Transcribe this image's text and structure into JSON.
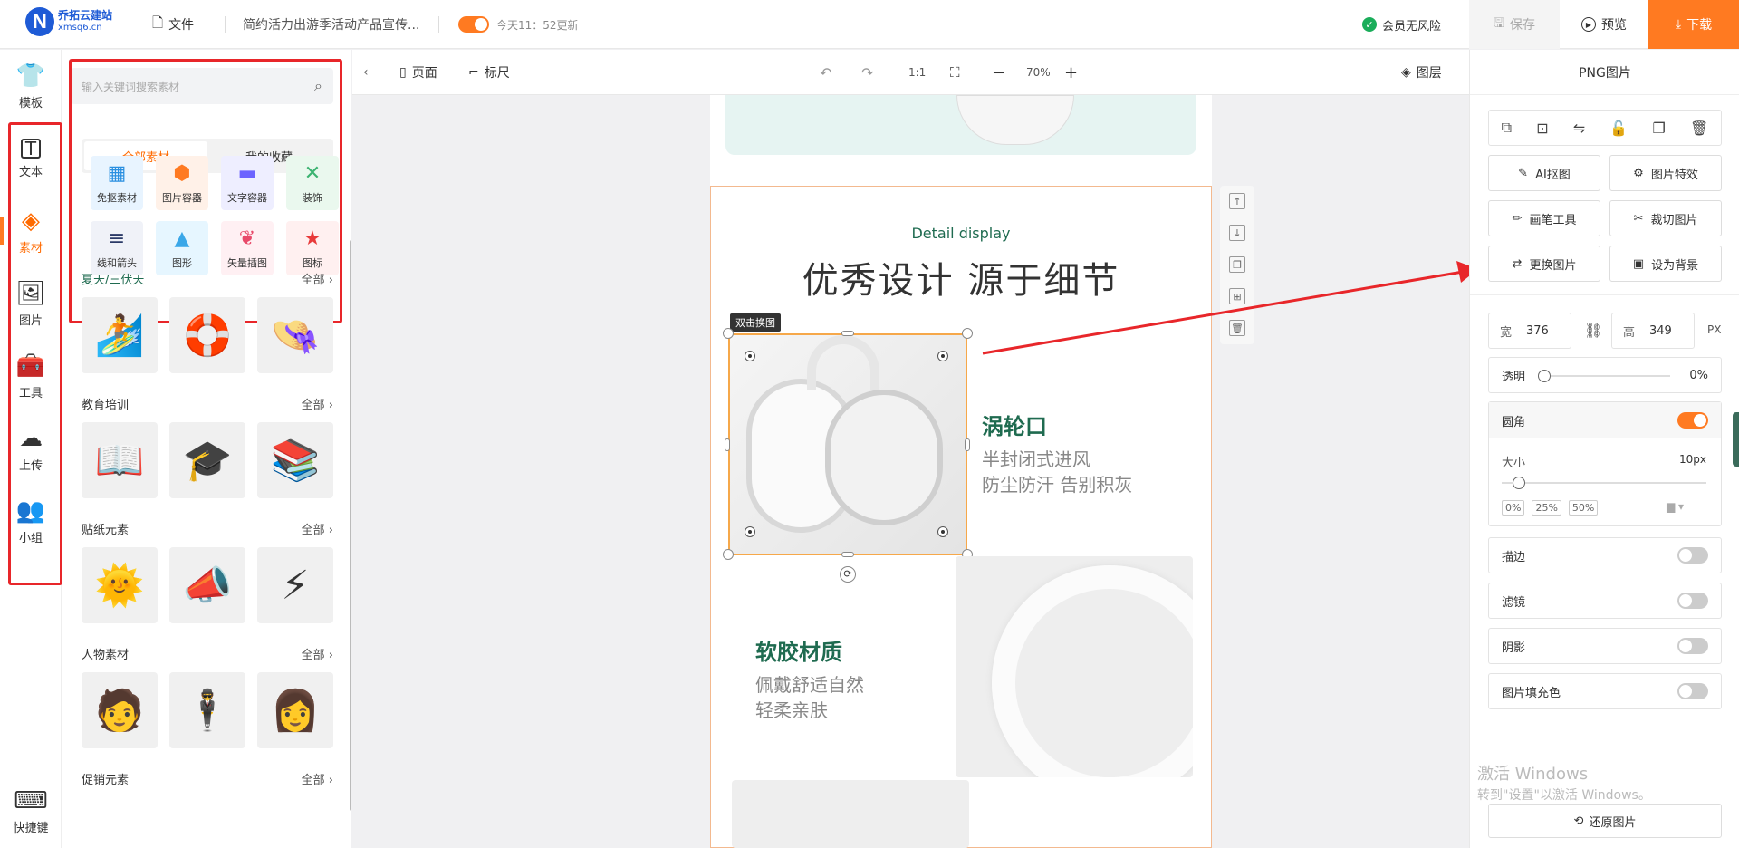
{
  "topbar": {
    "logo_text": "乔拓云建站",
    "logo_sub": "xmsq6.cn",
    "file_label": "文件",
    "doc_title": "简约活力出游季活动产品宣传...",
    "autosave_text": "今天11：52更新",
    "member_text": "会员无风险",
    "save_label": "保存",
    "preview_label": "预览",
    "download_label": "下载"
  },
  "leftnav": {
    "items": [
      {
        "label": "模板",
        "icon": "tshirt-icon"
      },
      {
        "label": "文本",
        "icon": "text-icon"
      },
      {
        "label": "素材",
        "icon": "shapes-icon"
      },
      {
        "label": "图片",
        "icon": "image-icon"
      },
      {
        "label": "工具",
        "icon": "toolbox-icon"
      },
      {
        "label": "上传",
        "icon": "upload-cloud-icon"
      },
      {
        "label": "小组",
        "icon": "group-icon"
      }
    ],
    "shortcut_label": "快捷键"
  },
  "panel": {
    "search_placeholder": "输入关键词搜索素材",
    "tabs": [
      "全部素材",
      "我的收藏"
    ],
    "categories": [
      {
        "label": "免抠素材",
        "color": "#e8f4ff",
        "glyph": "▦",
        "glyph_color": "#2a8fe0"
      },
      {
        "label": "图片容器",
        "color": "#fff1e8",
        "glyph": "⬢",
        "glyph_color": "#ff7a21"
      },
      {
        "label": "文字容器",
        "color": "#eeeeff",
        "glyph": "▬",
        "glyph_color": "#6c63ff"
      },
      {
        "label": "装饰",
        "color": "#eaf8ee",
        "glyph": "✕",
        "glyph_color": "#3cb371"
      },
      {
        "label": "线和箭头",
        "color": "#f0f2f8",
        "glyph": "≡",
        "glyph_color": "#2b3a67"
      },
      {
        "label": "图形",
        "color": "#e6f6ff",
        "glyph": "▲",
        "glyph_color": "#3aa7e8"
      },
      {
        "label": "矢量插图",
        "color": "#fff0f3",
        "glyph": "❦",
        "glyph_color": "#e84a6a"
      },
      {
        "label": "图标",
        "color": "#fff0f0",
        "glyph": "★",
        "glyph_color": "#e83a3a"
      }
    ],
    "sections": [
      {
        "title": "夏天/三伏天",
        "more": "全部",
        "thumbs": [
          "🏄",
          "🛟",
          "👒"
        ]
      },
      {
        "title": "教育培训",
        "more": "全部",
        "thumbs": [
          "📖",
          "🎓",
          "📚"
        ]
      },
      {
        "title": "贴纸元素",
        "more": "全部",
        "thumbs": [
          "🌞",
          "📣",
          "⚡"
        ]
      },
      {
        "title": "人物素材",
        "more": "全部",
        "thumbs": [
          "🧑",
          "🕴",
          "👩"
        ]
      },
      {
        "title": "促销元素",
        "more": "全部",
        "thumbs": []
      }
    ]
  },
  "canvasbar": {
    "page_label": "页面",
    "ruler_label": "标尺",
    "ratio_label": "1:1",
    "zoom": "70%",
    "layers_label": "图层"
  },
  "canvas": {
    "subtitle": "Detail display",
    "title": "优秀设计  源于细节",
    "replace_tag": "双击换图",
    "feature1_title": "涡轮口",
    "feature1_line1": "半封闭式进风",
    "feature1_line2": "防尘防汗 告别积灰",
    "feature2_title": "软胶材质",
    "feature2_line1": "佩戴舒适自然",
    "feature2_line2": "轻柔亲肤",
    "accent": "#1f6b50"
  },
  "right": {
    "title": "PNG图片",
    "buttons": [
      "AI抠图",
      "图片特效",
      "画笔工具",
      "裁切图片",
      "更换图片",
      "设为背景"
    ],
    "width_label": "宽",
    "width_value": "376",
    "height_label": "高",
    "height_value": "349",
    "unit": "PX",
    "opacity_label": "透明",
    "opacity_value": "0%",
    "radius_label": "圆角",
    "size_label": "大小",
    "size_value": "10px",
    "presets": [
      "0%",
      "25%",
      "50%"
    ],
    "stroke_label": "描边",
    "filter_label": "滤镜",
    "shadow_label": "阴影",
    "fill_label": "图片填充色",
    "restore_label": "还原图片",
    "watermark_line1": "激活 Windows",
    "watermark_line2": "转到\"设置\"以激活 Windows。"
  }
}
